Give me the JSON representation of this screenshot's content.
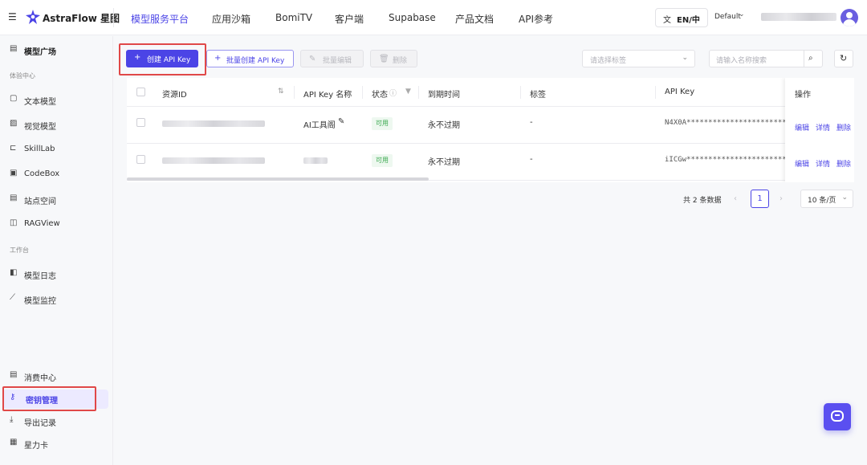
{
  "brand": {
    "name": "AstraFlow 星图"
  },
  "top_nav": {
    "items": [
      "模型服务平台",
      "应用沙箱",
      "BomiTV",
      "客户端",
      "Supabase",
      "产品文档",
      "API参考"
    ],
    "active_index": 0
  },
  "header": {
    "language_label": "EN/中",
    "workspace_label": "Default"
  },
  "sidebar": {
    "top_item": "模型广场",
    "section1_title": "体验中心",
    "section1_items": [
      "文本模型",
      "视觉模型",
      "SkillLab",
      "CodeBox",
      "站点空间",
      "RAGView"
    ],
    "section2_title": "工作台",
    "section2_items": [
      "模型日志",
      "模型监控"
    ],
    "bottom_items": [
      "消费中心",
      "密钥管理",
      "导出记录",
      "星力卡"
    ],
    "active_item": "密钥管理"
  },
  "toolbar": {
    "create_label": "创建 API Key",
    "batch_create_label": "批量创建 API Key",
    "batch_edit_label": "批量编辑",
    "delete_label": "删除",
    "tag_select_placeholder": "请选择标签",
    "search_placeholder": "请输入名称搜索"
  },
  "table": {
    "headers": {
      "resource_id": "资源ID",
      "name": "API Key 名称",
      "status": "状态",
      "expiry": "到期时间",
      "tags": "标签",
      "api_key": "API Key",
      "actions": "操作"
    },
    "rows": [
      {
        "name": "AI工具阁",
        "status": "可用",
        "expiry": "永不过期",
        "tags": "-",
        "api_key": "N4X0A************************",
        "actions": [
          "编辑",
          "详情",
          "删除"
        ]
      },
      {
        "name": "",
        "status": "可用",
        "expiry": "永不过期",
        "tags": "-",
        "api_key": "iICGw************************",
        "actions": [
          "编辑",
          "详情",
          "删除"
        ]
      }
    ]
  },
  "pagination": {
    "total_label": "共 2 条数据",
    "current_page": "1",
    "page_size_label": "10 条/页"
  },
  "colors": {
    "accent": "#4b44e6",
    "highlight_box": "#e04848",
    "status_green": "#3aa94f"
  }
}
